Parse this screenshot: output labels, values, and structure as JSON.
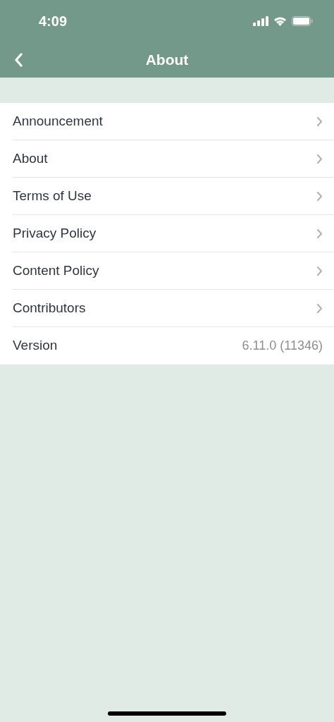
{
  "status_bar": {
    "time": "4:09"
  },
  "nav_bar": {
    "title": "About"
  },
  "items": [
    {
      "kind": "link",
      "label": "Announcement"
    },
    {
      "kind": "link",
      "label": "About"
    },
    {
      "kind": "link",
      "label": "Terms of Use"
    },
    {
      "kind": "link",
      "label": "Privacy Policy"
    },
    {
      "kind": "link",
      "label": "Content Policy"
    },
    {
      "kind": "link",
      "label": "Contributors"
    },
    {
      "kind": "value",
      "label": "Version",
      "value": "6.11.0 (11346)"
    }
  ]
}
